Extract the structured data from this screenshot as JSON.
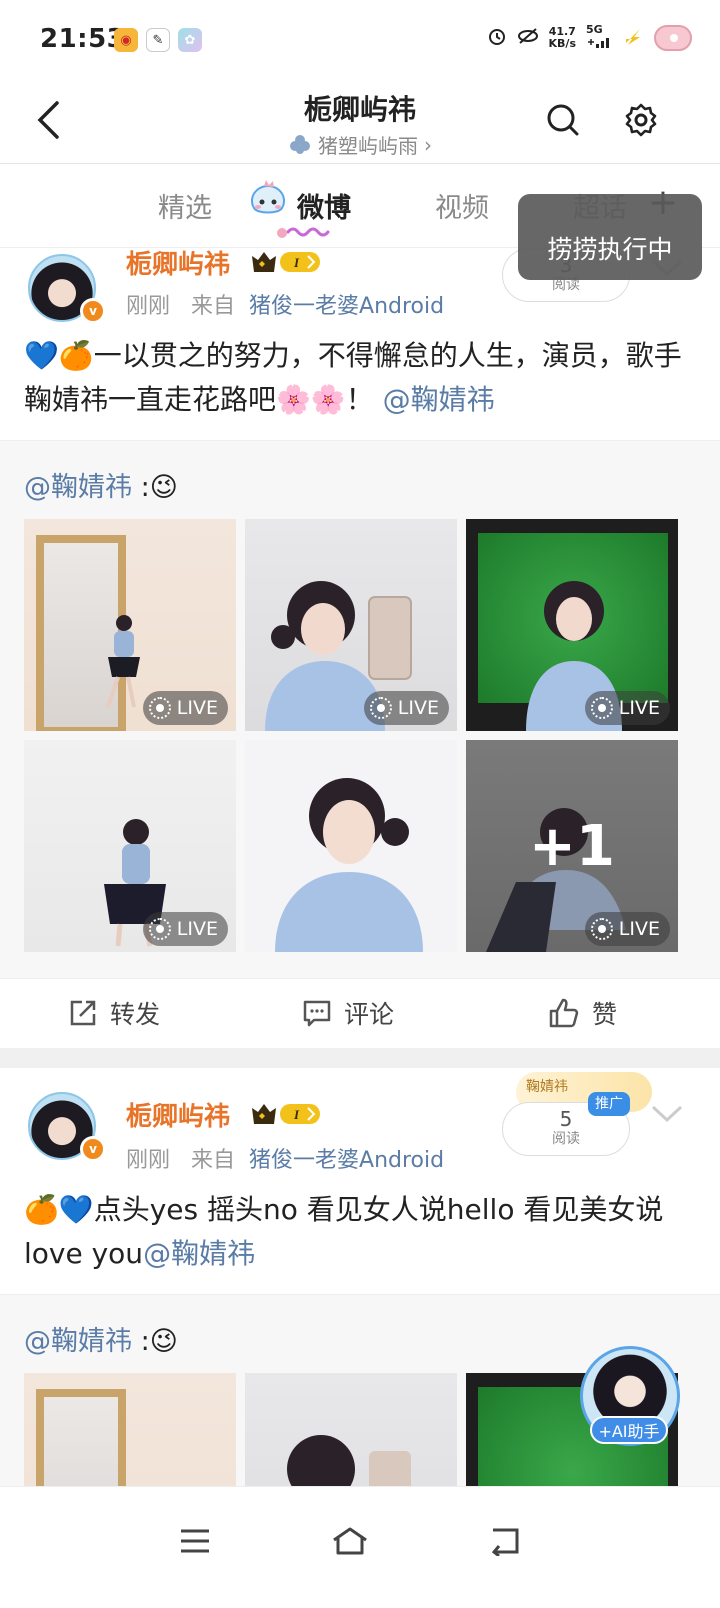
{
  "status_bar": {
    "time": "21:53",
    "speed_value": "41.7",
    "speed_unit": "KB/s",
    "network": "5G",
    "icons": [
      "weibo-app-icon",
      "notes-app-icon",
      "gallery-app-icon",
      "alarm-icon",
      "eye-off-icon",
      "signal-icon",
      "charging-icon",
      "donut-battery-icon"
    ]
  },
  "header": {
    "title": "栀卿屿祎",
    "subtitle": "猪塑屿屿雨",
    "subtitle_chevron": "›"
  },
  "tabs": [
    {
      "label": "精选",
      "active": false
    },
    {
      "label": "微博",
      "active": true
    },
    {
      "label": "视频",
      "active": false
    },
    {
      "label": "超话",
      "active": false
    }
  ],
  "tab_add": "+",
  "toast": "捞捞执行中",
  "posts": [
    {
      "username": "栀卿屿祎",
      "time": "刚刚",
      "from_prefix": "来自",
      "source": "猪俊一老婆Android",
      "reads_count": "3",
      "reads_label": "阅读",
      "text": "💙🍊一以贯之的努力，不得懈怠的人生，演员，歌手鞠婧祎一直走花路吧🌸🌸！",
      "mention": "@鞠婧祎",
      "quote_user": "@鞠婧祎",
      "quote_emoji": ":😉",
      "live_label": "LIVE",
      "more_count": "+1"
    },
    {
      "username": "栀卿屿祎",
      "time": "刚刚",
      "from_prefix": "来自",
      "source": "猪俊一老婆Android",
      "reads_count": "5",
      "reads_label": "阅读",
      "promo": "推广",
      "text": "🍊💙点头yes  摇头no  看见女人说hello  看见美女说love you",
      "mention": "@鞠婧祎",
      "quote_user": "@鞠婧祎",
      "quote_emoji": ":😉",
      "promo_badge": "鞠婧祎"
    }
  ],
  "actions": {
    "repost": "转发",
    "comment": "评论",
    "like": "赞"
  },
  "ai_assistant": "+AI助手",
  "colors": {
    "username": "#e8742a",
    "link": "#5a7ca6",
    "accent": "#3f8de6"
  }
}
